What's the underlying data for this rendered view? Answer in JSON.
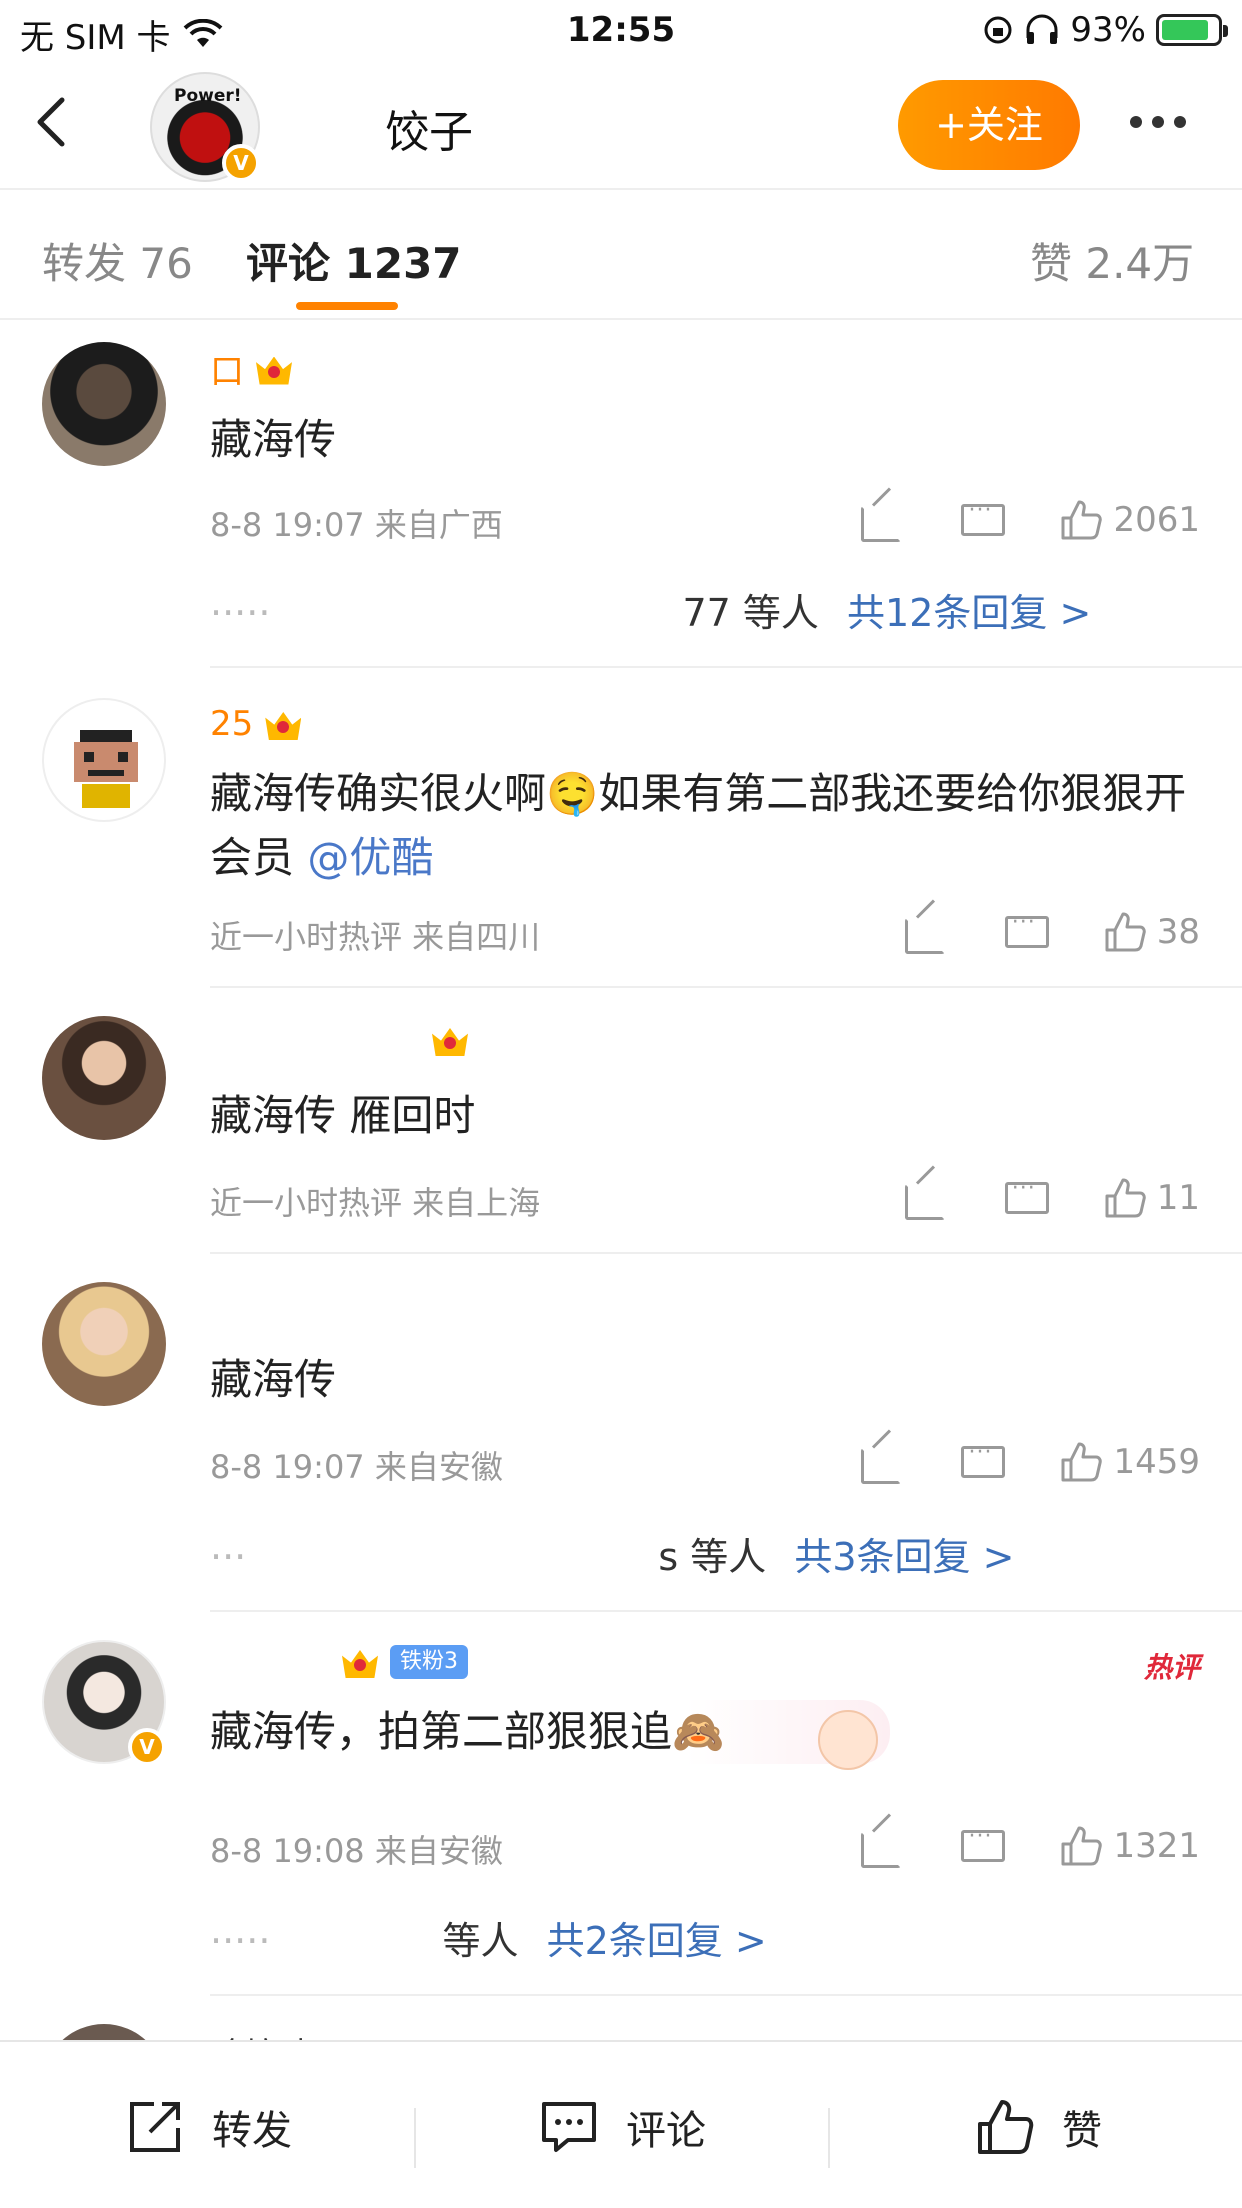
{
  "status_bar": {
    "carrier": "无 SIM 卡",
    "time": "12:55",
    "battery": "93%"
  },
  "header": {
    "name": "饺子",
    "follow_label": "+关注",
    "avatar_text": "Power!"
  },
  "tabs": [
    {
      "label": "转发 76"
    },
    {
      "label": "评论 1237"
    },
    {
      "label": "赞 2.4万"
    }
  ],
  "comments": [
    {
      "name": "口",
      "text": "藏海传",
      "meta": "8-8 19:07 来自广西",
      "likes": "2061",
      "reply_prefix": "·····",
      "reply_by": "77 等人",
      "reply_link": "共12条回复 >"
    },
    {
      "name": "25",
      "text_main": "藏海传确实很火啊🤤如果有第二部我还要给你狠狠开会员 ",
      "mention": "@优酷",
      "meta": "近一小时热评  来自四川",
      "likes": "38"
    },
    {
      "name": "",
      "text": "藏海传 雁回时",
      "meta": "近一小时热评  来自上海",
      "likes": "11"
    },
    {
      "name": "",
      "text": "藏海传",
      "meta": "8-8 19:07 来自安徽",
      "likes": "1459",
      "reply_prefix": "···",
      "reply_by": "s 等人",
      "reply_link": "共3条回复 >"
    },
    {
      "name": "",
      "fan_badge": "铁粉3",
      "hot_label": "热评",
      "text": "藏海传，拍第二部狠狠追🙈",
      "meta": "8-8 19:08 来自安徽",
      "likes": "1321",
      "reply_prefix": "·····",
      "reply_by": "等人",
      "reply_link": "共2条回复 >"
    },
    {
      "name": "晗烷晴"
    }
  ],
  "bottom_bar": {
    "repost": "转发",
    "comment": "评论",
    "like": "赞"
  },
  "colors": {
    "accent": "#ff8200",
    "link": "#3c6fb8",
    "hot": "#e0283a"
  }
}
